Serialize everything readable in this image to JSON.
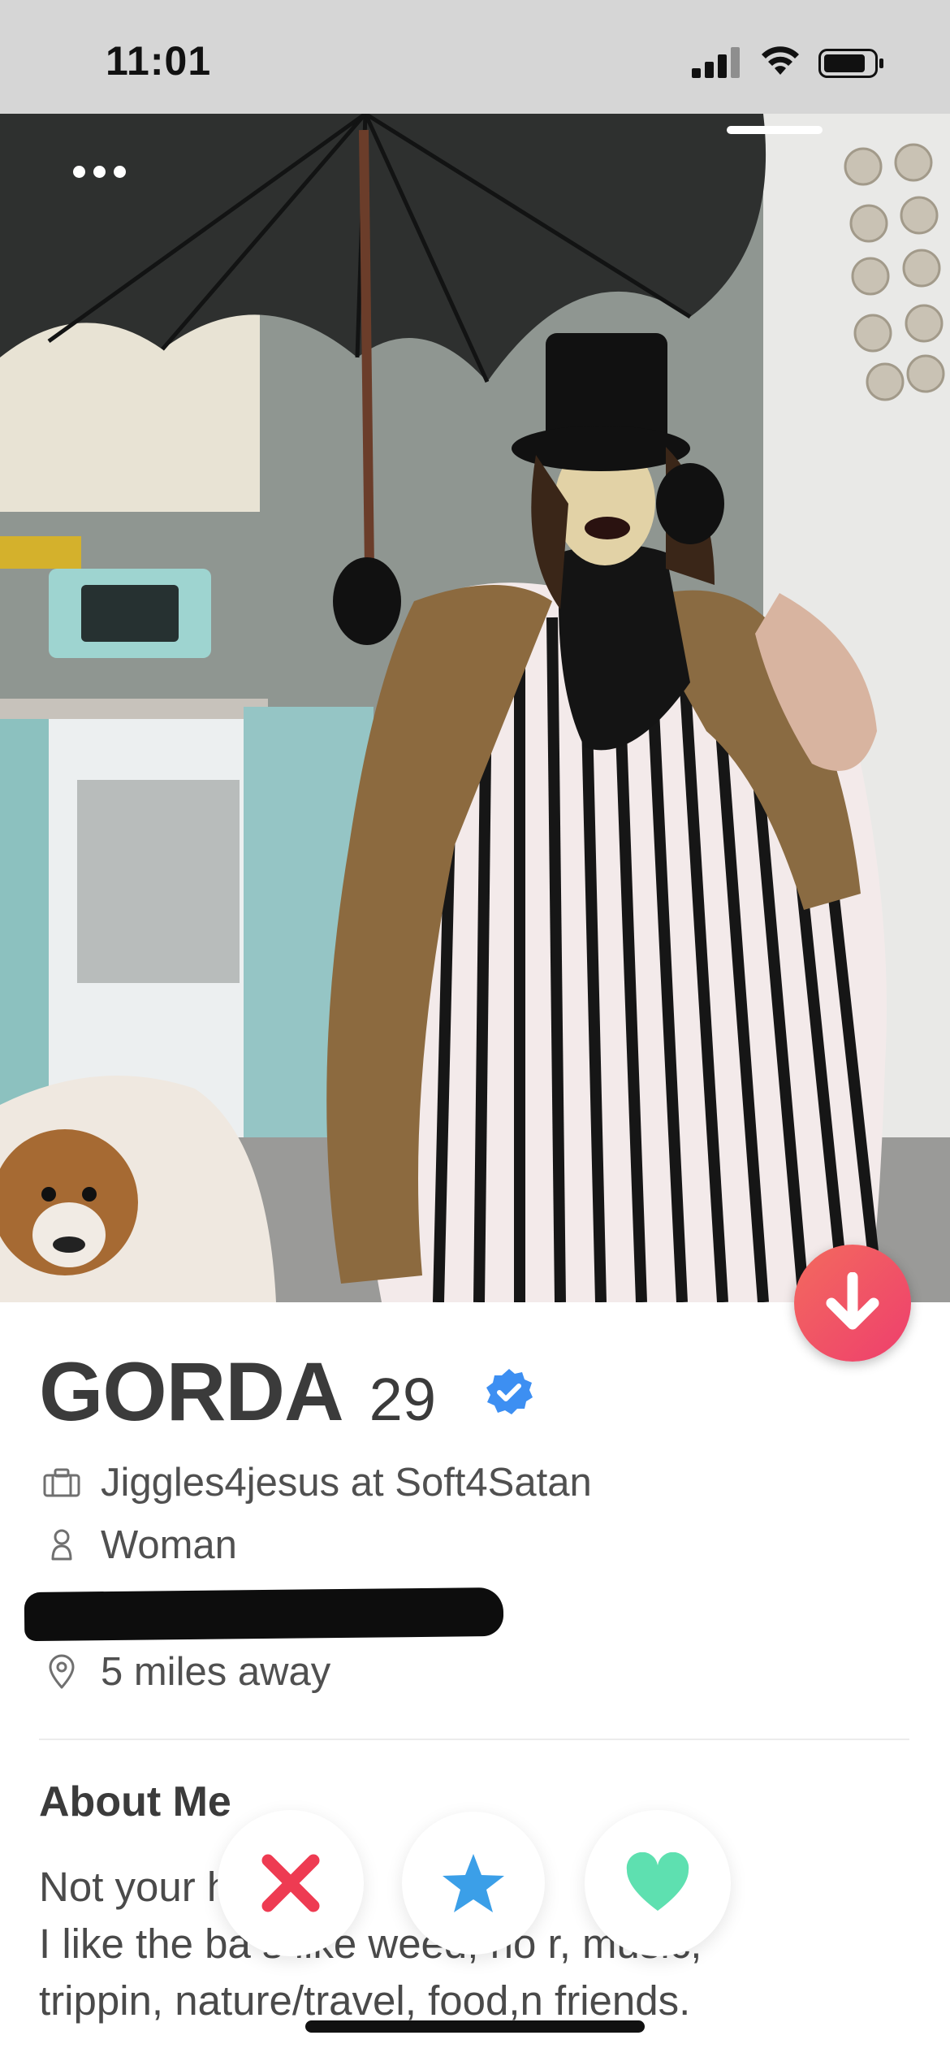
{
  "status_bar": {
    "time": "11:01"
  },
  "photo": {
    "indicator_count": 1,
    "more_icon": "more-horizontal-icon"
  },
  "profile": {
    "name": "GORDA",
    "age": "29",
    "verified": true,
    "job": "Jiggles4jesus at Soft4Satan",
    "gender": "Woman",
    "distance": "5 miles away"
  },
  "about": {
    "title": "About Me",
    "bio_line1": "Not your         hu        bu",
    "bio_line2": "I like the ba     s like weed, ho   r, music,",
    "bio_line3": "trippin, nature/travel, food,n friends."
  },
  "actions": [
    {
      "name": "nope",
      "icon": "close-icon",
      "color": "#ee3b52"
    },
    {
      "name": "super-like",
      "icon": "star-icon",
      "color": "#3b9fe8"
    },
    {
      "name": "like",
      "icon": "heart-icon",
      "color": "#5ee0b0"
    }
  ],
  "colors": {
    "status_bar": "#d6d6d6",
    "down_button": "#f0506a",
    "verified": "#3d8ff2"
  }
}
